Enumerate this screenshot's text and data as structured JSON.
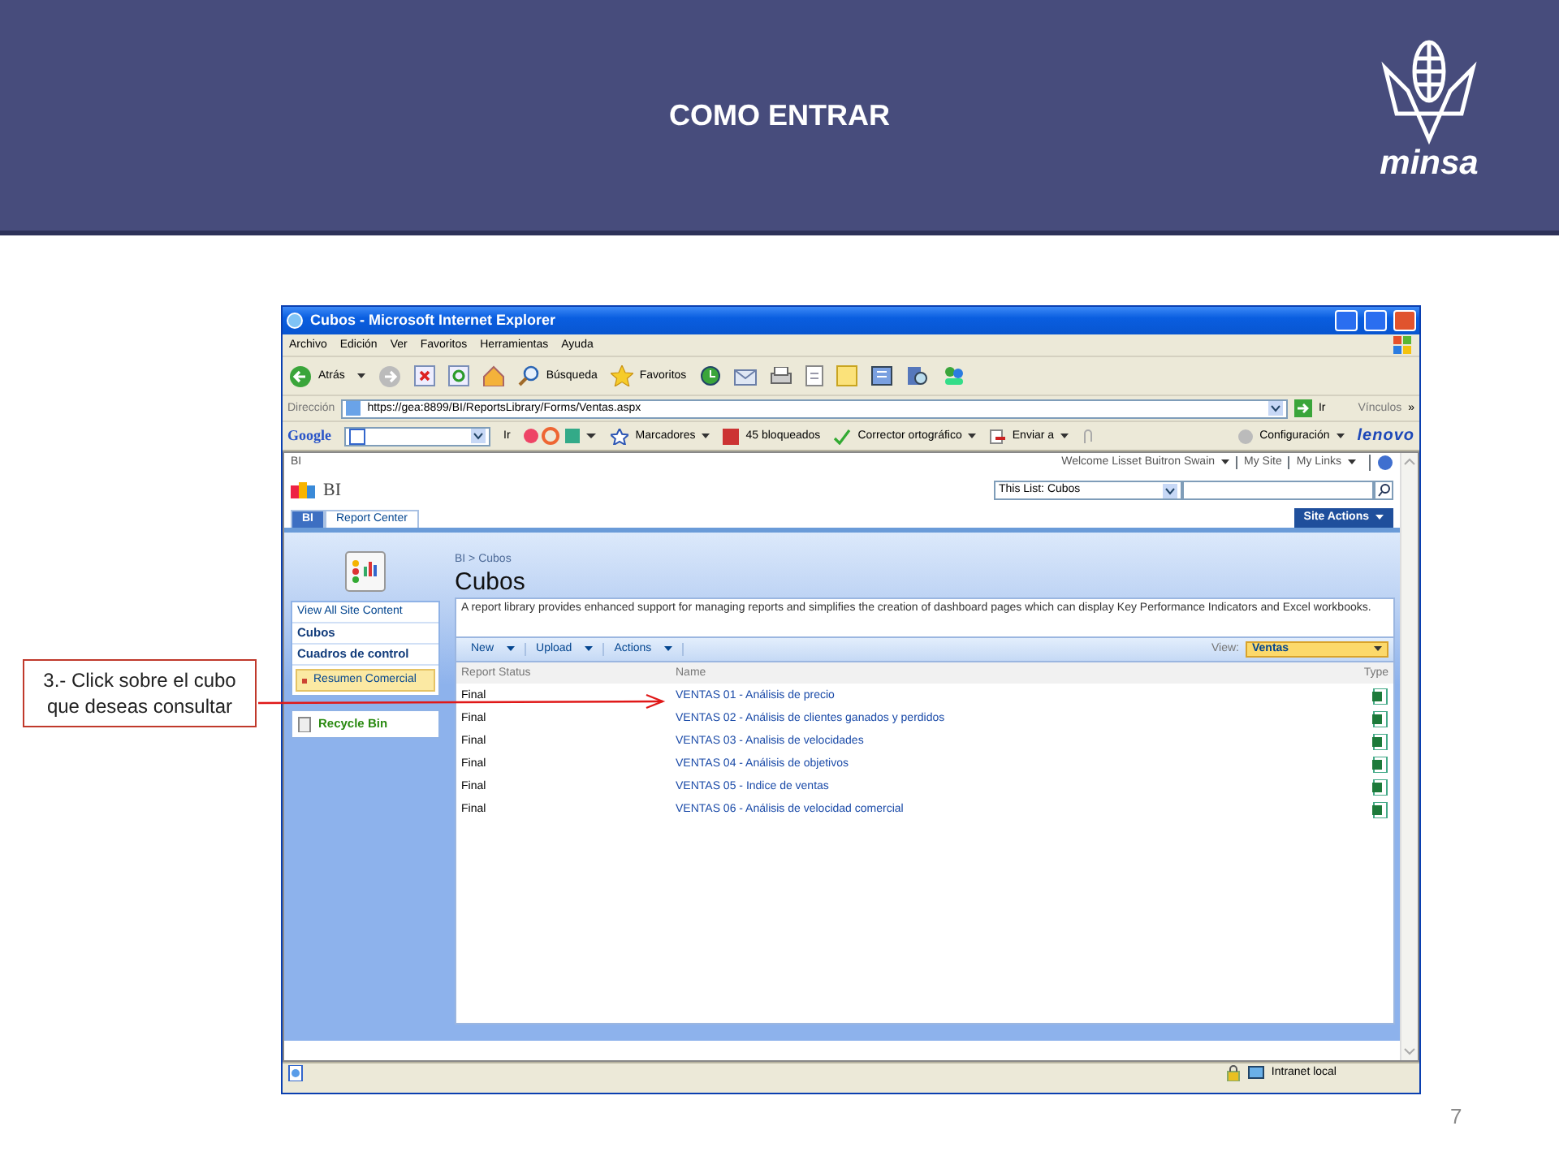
{
  "slide": {
    "title": "COMO ENTRAR",
    "logo_text": "minsa",
    "page_number": "7"
  },
  "callout": {
    "text": "3.- Click sobre el cubo que deseas consultar"
  },
  "browser": {
    "title": "Cubos - Microsoft Internet Explorer",
    "menu": [
      "Archivo",
      "Edición",
      "Ver",
      "Favoritos",
      "Herramientas",
      "Ayuda"
    ],
    "toolbar": {
      "back": "Atrás",
      "search": "Búsqueda",
      "favorites": "Favoritos"
    },
    "address": {
      "label": "Dirección",
      "url": "https://gea:8899/BI/ReportsLibrary/Forms/Ventas.aspx",
      "go": "Ir",
      "links": "Vínculos",
      "more": "»"
    },
    "google_bar": {
      "logo": "Google",
      "go": "Ir",
      "bookmarks": "Marcadores",
      "blocked": "45 bloqueados",
      "spellcheck": "Corrector ortográfico",
      "send": "Enviar a",
      "settings": "Configuración",
      "brand": "lenovo"
    },
    "status_bar": {
      "zone": "Intranet local"
    }
  },
  "site": {
    "top_label": "BI",
    "welcome": "Welcome Lisset Buitron Swain",
    "my_site": "My Site",
    "my_links": "My Links",
    "site_name": "BI",
    "search_scope": "This List: Cubos",
    "tabs": [
      {
        "label": "BI",
        "selected": true
      },
      {
        "label": "Report Center",
        "selected": false
      }
    ],
    "site_actions": "Site Actions",
    "breadcrumb": "BI > Cubos",
    "page_title": "Cubos",
    "nav": [
      {
        "label": "View All Site Content",
        "kind": "link",
        "selected": false
      },
      {
        "label": "Cubos",
        "kind": "heading",
        "selected": false
      },
      {
        "label": "Cuadros de control",
        "kind": "heading",
        "selected": false
      },
      {
        "label": "Resumen Comercial",
        "kind": "item",
        "selected": true
      }
    ],
    "recycle_bin": "Recycle Bin",
    "description": "A report library provides enhanced support for managing reports and simplifies the creation of dashboard pages which can display Key Performance Indicators and Excel workbooks.",
    "list_toolbar": [
      "New",
      "Upload",
      "Actions"
    ],
    "view_label": "View:",
    "view": "Ventas",
    "columns": [
      "Report Status",
      "Name",
      "Type"
    ],
    "rows": [
      {
        "status": "Final",
        "name": "VENTAS 01 - Análisis de precio"
      },
      {
        "status": "Final",
        "name": "VENTAS 02 - Análisis de clientes ganados y perdidos"
      },
      {
        "status": "Final",
        "name": "VENTAS 03 - Analisis de velocidades"
      },
      {
        "status": "Final",
        "name": "VENTAS 04 - Análisis de objetivos"
      },
      {
        "status": "Final",
        "name": "VENTAS 05 - Indice de ventas"
      },
      {
        "status": "Final",
        "name": "VENTAS 06 - Análisis de velocidad comercial"
      }
    ]
  }
}
